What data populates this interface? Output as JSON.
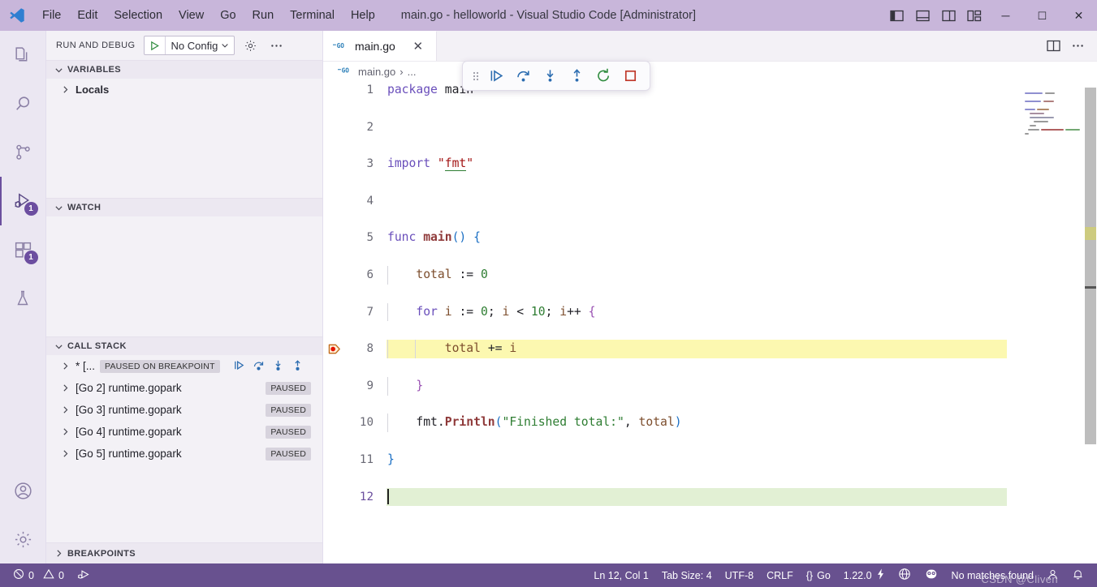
{
  "titlebar": {
    "logo_icon": "vscode-logo-icon",
    "menus": [
      "File",
      "Edit",
      "Selection",
      "View",
      "Go",
      "Run",
      "Terminal",
      "Help"
    ],
    "window_title": "main.go - helloworld - Visual Studio Code [Administrator]",
    "layout_buttons": [
      {
        "name": "toggle-primary-sidebar-icon",
        "label": "Toggle Primary Side Bar"
      },
      {
        "name": "toggle-panel-icon",
        "label": "Toggle Panel"
      },
      {
        "name": "toggle-secondary-sidebar-icon",
        "label": "Toggle Secondary Side Bar"
      },
      {
        "name": "customize-layout-icon",
        "label": "Customize Layout"
      }
    ],
    "window_controls": [
      {
        "name": "minimize-button",
        "glyph": "─"
      },
      {
        "name": "maximize-button",
        "glyph": "☐"
      },
      {
        "name": "close-button",
        "glyph": "✕"
      }
    ]
  },
  "activitybar": {
    "items": [
      {
        "name": "explorer",
        "icon": "files-icon",
        "badge": "",
        "active": false
      },
      {
        "name": "search",
        "icon": "search-icon",
        "badge": "",
        "active": false
      },
      {
        "name": "source-control",
        "icon": "source-control-icon",
        "badge": "",
        "active": false
      },
      {
        "name": "run-and-debug",
        "icon": "run-and-debug-icon",
        "badge": "1",
        "active": true
      },
      {
        "name": "extensions",
        "icon": "extensions-icon",
        "badge": "1",
        "active": false
      },
      {
        "name": "testing",
        "icon": "beaker-icon",
        "badge": "",
        "active": false
      }
    ],
    "bottom": [
      {
        "name": "accounts",
        "icon": "account-icon"
      },
      {
        "name": "manage",
        "icon": "gear-icon"
      }
    ]
  },
  "sidebar": {
    "title": "RUN AND DEBUG",
    "config": {
      "play_icon": "green-play-icon",
      "value": "No Config",
      "chevron": "chevron-down-icon"
    },
    "gear_icon": "gear-icon",
    "more_icon": "ellipsis-icon",
    "sections": {
      "variables": {
        "label": "VARIABLES",
        "expanded": true,
        "rows": [
          {
            "label": "Locals",
            "expanded": false
          }
        ]
      },
      "watch": {
        "label": "WATCH",
        "expanded": true,
        "rows": []
      },
      "callstack": {
        "label": "CALL STACK",
        "expanded": true,
        "rows": [
          {
            "label": "* [...",
            "badge": "PAUSED ON BREAKPOINT",
            "actions": [
              "continue-icon",
              "step-over-icon",
              "step-into-icon",
              "step-out-icon"
            ]
          },
          {
            "label": "[Go 2] runtime.gopark",
            "badge": "PAUSED",
            "actions": []
          },
          {
            "label": "[Go 3] runtime.gopark",
            "badge": "PAUSED",
            "actions": []
          },
          {
            "label": "[Go 4] runtime.gopark",
            "badge": "PAUSED",
            "actions": []
          },
          {
            "label": "[Go 5] runtime.gopark",
            "badge": "PAUSED",
            "actions": []
          }
        ]
      },
      "breakpoints": {
        "label": "BREAKPOINTS",
        "expanded": false,
        "rows": []
      }
    }
  },
  "editor": {
    "tab": {
      "icon": "go-file-icon",
      "label": "main.go",
      "close": "✕"
    },
    "tab_actions": [
      {
        "name": "split-editor-icon"
      },
      {
        "name": "more-actions-icon"
      }
    ],
    "breadcrumb": {
      "icon": "go-file-icon",
      "file": "main.go",
      "separator": "›",
      "rest": "..."
    },
    "language": "go",
    "breakpoint_line": 8,
    "current_line": 8,
    "cursor_line": 12,
    "lines": [
      {
        "n": 1,
        "text": "package main"
      },
      {
        "n": 2,
        "text": ""
      },
      {
        "n": 3,
        "text": "import \"fmt\""
      },
      {
        "n": 4,
        "text": ""
      },
      {
        "n": 5,
        "text": "func main() {"
      },
      {
        "n": 6,
        "text": "    total := 0"
      },
      {
        "n": 7,
        "text": "    for i := 0; i < 10; i++ {"
      },
      {
        "n": 8,
        "text": "        total += i"
      },
      {
        "n": 9,
        "text": "    }"
      },
      {
        "n": 10,
        "text": "    fmt.Println(\"Finished total:\", total)"
      },
      {
        "n": 11,
        "text": "}"
      },
      {
        "n": 12,
        "text": ""
      }
    ]
  },
  "debug_toolbar": {
    "grip_icon": "drag-handle-icon",
    "buttons": [
      {
        "name": "continue-button",
        "icon": "continue-icon",
        "color": "#2b6cb0"
      },
      {
        "name": "step-over-button",
        "icon": "step-over-icon",
        "color": "#2b6cb0"
      },
      {
        "name": "step-into-button",
        "icon": "step-into-icon",
        "color": "#2b6cb0"
      },
      {
        "name": "step-out-button",
        "icon": "step-out-icon",
        "color": "#2b6cb0"
      },
      {
        "name": "restart-button",
        "icon": "restart-icon",
        "color": "#2e8b3d"
      },
      {
        "name": "stop-button",
        "icon": "stop-icon",
        "color": "#c0392b"
      }
    ]
  },
  "statusbar": {
    "errors_icon": "error-icon",
    "errors": "0",
    "warnings_icon": "warning-icon",
    "warnings": "0",
    "debug_icon": "debug-console-icon",
    "right": {
      "position": "Ln 12, Col 1",
      "tab_size": "Tab Size: 4",
      "encoding": "UTF-8",
      "eol": "CRLF",
      "lang_icon": "{}",
      "language": "Go",
      "go_version": "1.22.0",
      "go_version_icon": "zap-icon",
      "remote_icon": "remote-icon",
      "gopls_icon": "go-gopher-icon",
      "search_status": "No matches found",
      "account_icon": "account-icon",
      "bell_icon": "bell-icon"
    }
  },
  "watermark": "CSDN @Cliven",
  "colors": {
    "titlebar_bg": "#c8b6da",
    "statusbar_bg": "#68518f",
    "sidebar_bg": "#f3f1f6",
    "activitybar_bg": "#ebe7f2",
    "accent": "#6b4f9e",
    "current_line_yellow": "#fcf8b0",
    "cursor_line_green": "#e2f0d4",
    "badge_bg": "#d7d3dd"
  }
}
